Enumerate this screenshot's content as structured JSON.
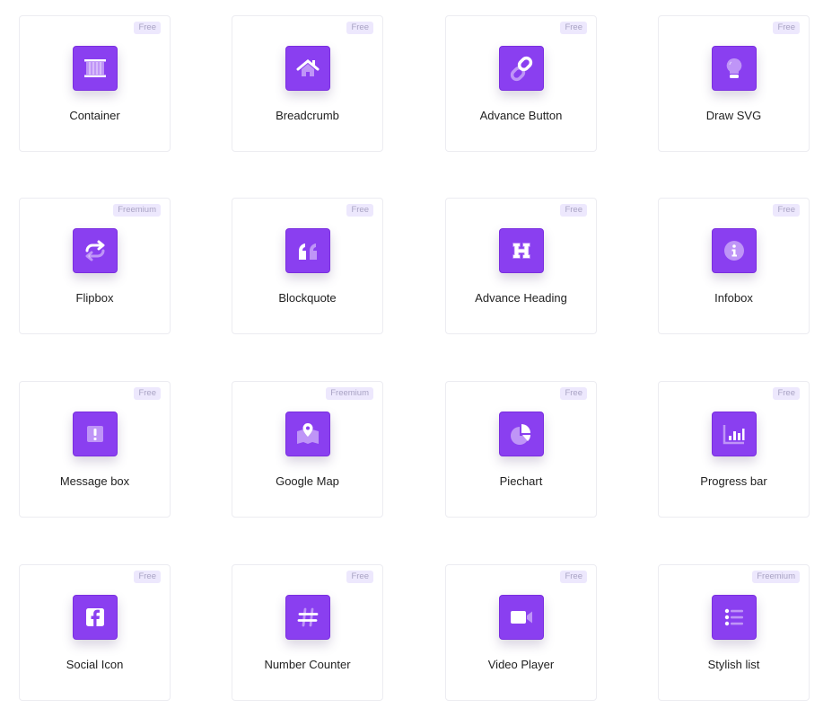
{
  "colors": {
    "icon_bg": "#8a3ff0",
    "badge_bg": "#ede8fd",
    "badge_text": "#a9a3c4"
  },
  "widgets": [
    {
      "label": "Container",
      "badge": "Free",
      "icon": "container-icon"
    },
    {
      "label": "Breadcrumb",
      "badge": "Free",
      "icon": "home-icon"
    },
    {
      "label": "Advance Button",
      "badge": "Free",
      "icon": "link-icon"
    },
    {
      "label": "Draw SVG",
      "badge": "Free",
      "icon": "lightbulb-icon"
    },
    {
      "label": "Flipbox",
      "badge": "Freemium",
      "icon": "repeat-icon"
    },
    {
      "label": "Blockquote",
      "badge": "Free",
      "icon": "quote-icon"
    },
    {
      "label": "Advance Heading",
      "badge": "Free",
      "icon": "heading-icon"
    },
    {
      "label": "Infobox",
      "badge": "Free",
      "icon": "info-icon"
    },
    {
      "label": "Message box",
      "badge": "Free",
      "icon": "alert-icon"
    },
    {
      "label": "Google Map",
      "badge": "Freemium",
      "icon": "map-icon"
    },
    {
      "label": "Piechart",
      "badge": "Free",
      "icon": "pie-chart-icon"
    },
    {
      "label": "Progress bar",
      "badge": "Free",
      "icon": "bar-chart-icon"
    },
    {
      "label": "Social Icon",
      "badge": "Free",
      "icon": "facebook-icon"
    },
    {
      "label": "Number Counter",
      "badge": "Free",
      "icon": "hashtag-icon"
    },
    {
      "label": "Video Player",
      "badge": "Free",
      "icon": "video-icon"
    },
    {
      "label": "Stylish list",
      "badge": "Freemium",
      "icon": "list-icon"
    }
  ]
}
